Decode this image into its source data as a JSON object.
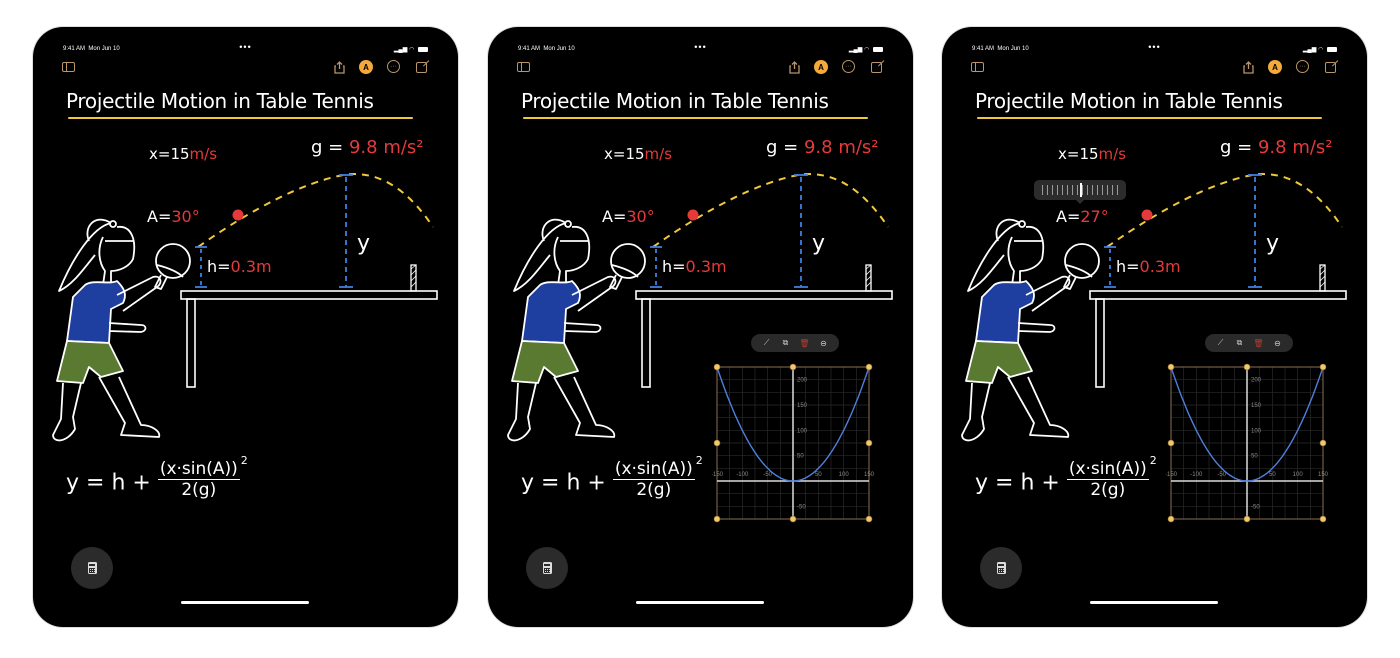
{
  "status_bar": {
    "time": "9:41 AM",
    "date": "Mon Jun 10",
    "dots": "•••"
  },
  "toolbar": {
    "icons": [
      "sidebar-icon",
      "share-icon",
      "markup-icon",
      "more-icon",
      "compose-icon"
    ],
    "markup_glyph": "A",
    "more_glyph": "···"
  },
  "note": {
    "title": "Projectile Motion in Table Tennis",
    "x_label": "x=",
    "x_value": "15",
    "x_unit": "m/s",
    "g_label": "g =",
    "g_value": "9.8 m/s²",
    "a_label": "A=",
    "h_label": "h=",
    "h_value": "0.3m",
    "y_label": "y",
    "formula_lhs": "y = h +",
    "formula_num": "(x·sin(A))",
    "formula_exp": "2",
    "formula_den": "2(g)"
  },
  "panels": [
    {
      "angle_value": "30°",
      "show_graph": false,
      "show_scrubber": false
    },
    {
      "angle_value": "30°",
      "show_graph": true,
      "show_scrubber": false
    },
    {
      "angle_value": "27°",
      "show_graph": true,
      "show_scrubber": true
    }
  ],
  "graph_toolbar": {
    "icons": [
      "graph-icon",
      "duplicate-icon",
      "trash-icon",
      "minus-circle-icon"
    ]
  },
  "colors": {
    "accent": "#f4a93b",
    "red_values": "#e5393a",
    "curve": "#4f7fd9",
    "trajectory": "#f0c93a",
    "measure": "#3f7fe0",
    "shirt": "#1f3fa0",
    "shorts": "#5a7a32"
  },
  "chart_data": {
    "type": "line",
    "title": "",
    "xlabel": "",
    "ylabel": "",
    "x_ticks": [
      "-150",
      "-100",
      "-50",
      "50",
      "100",
      "150"
    ],
    "y_ticks": [
      "200",
      "150",
      "100",
      "50",
      "-50"
    ],
    "xlim": [
      -150,
      150
    ],
    "ylim": [
      -75,
      225
    ],
    "series": [
      {
        "name": "y = h + (x·sin(A))²/(2g)",
        "function": "parabola",
        "vertex": [
          0,
          0.3
        ]
      }
    ],
    "grid": true
  }
}
